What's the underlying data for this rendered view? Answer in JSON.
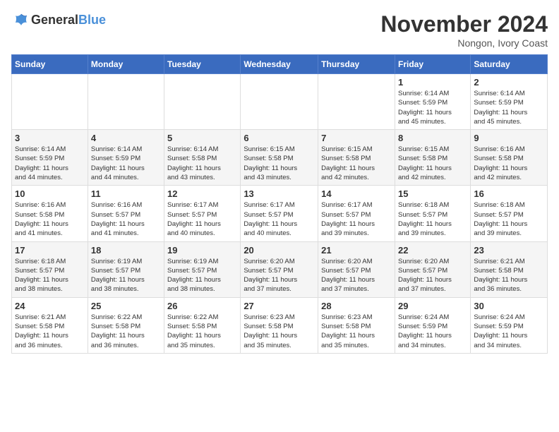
{
  "logo": {
    "text_general": "General",
    "text_blue": "Blue"
  },
  "title": {
    "month": "November 2024",
    "location": "Nongon, Ivory Coast"
  },
  "weekdays": [
    "Sunday",
    "Monday",
    "Tuesday",
    "Wednesday",
    "Thursday",
    "Friday",
    "Saturday"
  ],
  "weeks": [
    [
      {
        "day": "",
        "info": ""
      },
      {
        "day": "",
        "info": ""
      },
      {
        "day": "",
        "info": ""
      },
      {
        "day": "",
        "info": ""
      },
      {
        "day": "",
        "info": ""
      },
      {
        "day": "1",
        "info": "Sunrise: 6:14 AM\nSunset: 5:59 PM\nDaylight: 11 hours\nand 45 minutes."
      },
      {
        "day": "2",
        "info": "Sunrise: 6:14 AM\nSunset: 5:59 PM\nDaylight: 11 hours\nand 45 minutes."
      }
    ],
    [
      {
        "day": "3",
        "info": "Sunrise: 6:14 AM\nSunset: 5:59 PM\nDaylight: 11 hours\nand 44 minutes."
      },
      {
        "day": "4",
        "info": "Sunrise: 6:14 AM\nSunset: 5:59 PM\nDaylight: 11 hours\nand 44 minutes."
      },
      {
        "day": "5",
        "info": "Sunrise: 6:14 AM\nSunset: 5:58 PM\nDaylight: 11 hours\nand 43 minutes."
      },
      {
        "day": "6",
        "info": "Sunrise: 6:15 AM\nSunset: 5:58 PM\nDaylight: 11 hours\nand 43 minutes."
      },
      {
        "day": "7",
        "info": "Sunrise: 6:15 AM\nSunset: 5:58 PM\nDaylight: 11 hours\nand 42 minutes."
      },
      {
        "day": "8",
        "info": "Sunrise: 6:15 AM\nSunset: 5:58 PM\nDaylight: 11 hours\nand 42 minutes."
      },
      {
        "day": "9",
        "info": "Sunrise: 6:16 AM\nSunset: 5:58 PM\nDaylight: 11 hours\nand 42 minutes."
      }
    ],
    [
      {
        "day": "10",
        "info": "Sunrise: 6:16 AM\nSunset: 5:58 PM\nDaylight: 11 hours\nand 41 minutes."
      },
      {
        "day": "11",
        "info": "Sunrise: 6:16 AM\nSunset: 5:57 PM\nDaylight: 11 hours\nand 41 minutes."
      },
      {
        "day": "12",
        "info": "Sunrise: 6:17 AM\nSunset: 5:57 PM\nDaylight: 11 hours\nand 40 minutes."
      },
      {
        "day": "13",
        "info": "Sunrise: 6:17 AM\nSunset: 5:57 PM\nDaylight: 11 hours\nand 40 minutes."
      },
      {
        "day": "14",
        "info": "Sunrise: 6:17 AM\nSunset: 5:57 PM\nDaylight: 11 hours\nand 39 minutes."
      },
      {
        "day": "15",
        "info": "Sunrise: 6:18 AM\nSunset: 5:57 PM\nDaylight: 11 hours\nand 39 minutes."
      },
      {
        "day": "16",
        "info": "Sunrise: 6:18 AM\nSunset: 5:57 PM\nDaylight: 11 hours\nand 39 minutes."
      }
    ],
    [
      {
        "day": "17",
        "info": "Sunrise: 6:18 AM\nSunset: 5:57 PM\nDaylight: 11 hours\nand 38 minutes."
      },
      {
        "day": "18",
        "info": "Sunrise: 6:19 AM\nSunset: 5:57 PM\nDaylight: 11 hours\nand 38 minutes."
      },
      {
        "day": "19",
        "info": "Sunrise: 6:19 AM\nSunset: 5:57 PM\nDaylight: 11 hours\nand 38 minutes."
      },
      {
        "day": "20",
        "info": "Sunrise: 6:20 AM\nSunset: 5:57 PM\nDaylight: 11 hours\nand 37 minutes."
      },
      {
        "day": "21",
        "info": "Sunrise: 6:20 AM\nSunset: 5:57 PM\nDaylight: 11 hours\nand 37 minutes."
      },
      {
        "day": "22",
        "info": "Sunrise: 6:20 AM\nSunset: 5:57 PM\nDaylight: 11 hours\nand 37 minutes."
      },
      {
        "day": "23",
        "info": "Sunrise: 6:21 AM\nSunset: 5:58 PM\nDaylight: 11 hours\nand 36 minutes."
      }
    ],
    [
      {
        "day": "24",
        "info": "Sunrise: 6:21 AM\nSunset: 5:58 PM\nDaylight: 11 hours\nand 36 minutes."
      },
      {
        "day": "25",
        "info": "Sunrise: 6:22 AM\nSunset: 5:58 PM\nDaylight: 11 hours\nand 36 minutes."
      },
      {
        "day": "26",
        "info": "Sunrise: 6:22 AM\nSunset: 5:58 PM\nDaylight: 11 hours\nand 35 minutes."
      },
      {
        "day": "27",
        "info": "Sunrise: 6:23 AM\nSunset: 5:58 PM\nDaylight: 11 hours\nand 35 minutes."
      },
      {
        "day": "28",
        "info": "Sunrise: 6:23 AM\nSunset: 5:58 PM\nDaylight: 11 hours\nand 35 minutes."
      },
      {
        "day": "29",
        "info": "Sunrise: 6:24 AM\nSunset: 5:59 PM\nDaylight: 11 hours\nand 34 minutes."
      },
      {
        "day": "30",
        "info": "Sunrise: 6:24 AM\nSunset: 5:59 PM\nDaylight: 11 hours\nand 34 minutes."
      }
    ]
  ]
}
